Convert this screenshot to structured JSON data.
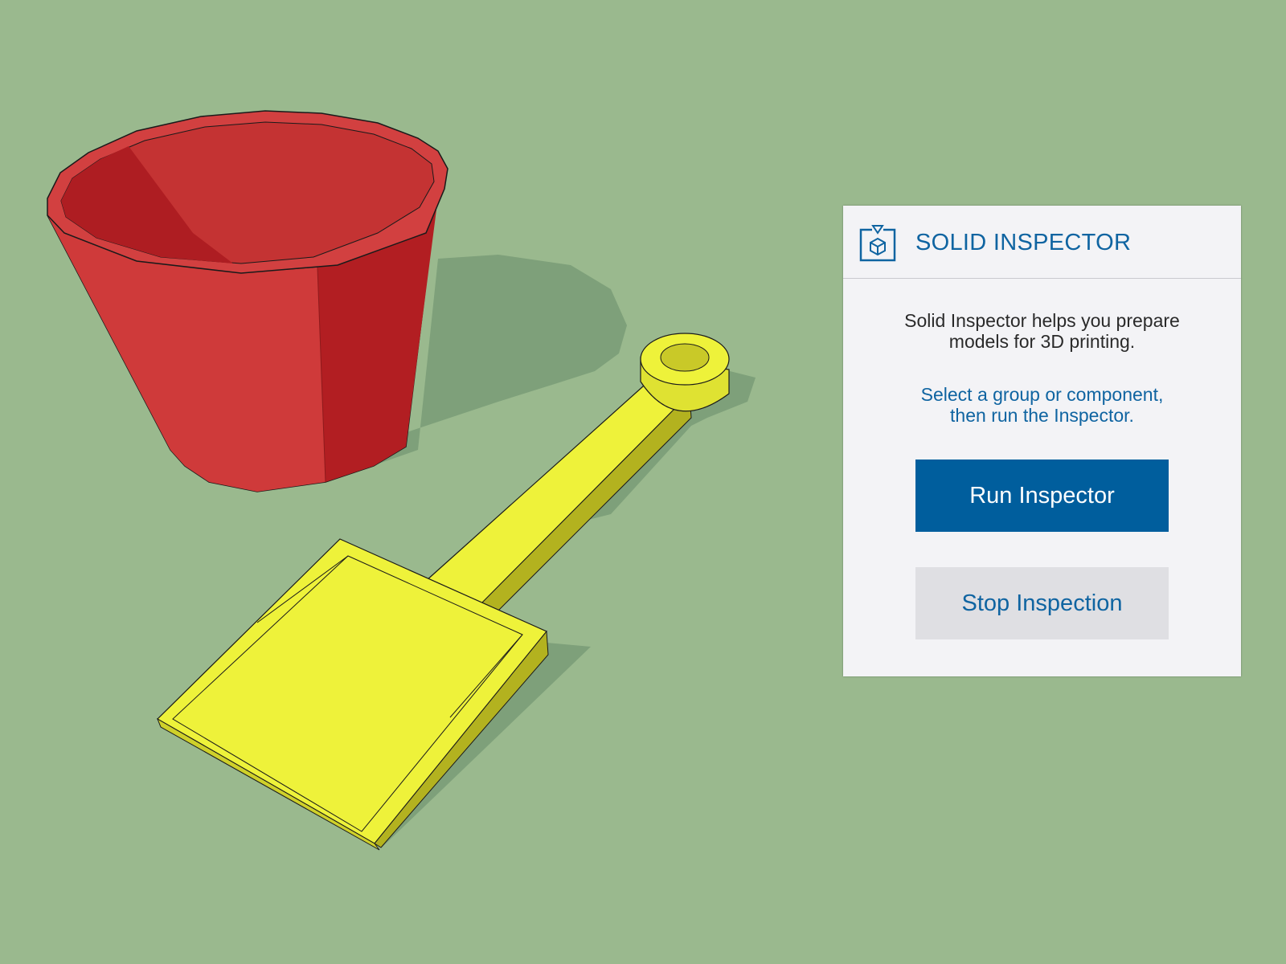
{
  "colors": {
    "background": "#9ab98e",
    "bucket_red": "#cc3535",
    "shovel_yellow": "#eef23a",
    "accent_blue": "#005e9d",
    "panel_bg": "#f3f3f6"
  },
  "panel": {
    "icon": "solid-inspector-cube-icon",
    "title": "SOLID INSPECTOR",
    "description_line1": "Solid Inspector helps you prepare",
    "description_line2": "models for 3D printing.",
    "hint_line1": "Select a group or component,",
    "hint_line2": "then run the Inspector.",
    "run_button_label": "Run Inspector",
    "stop_button_label": "Stop Inspection"
  }
}
